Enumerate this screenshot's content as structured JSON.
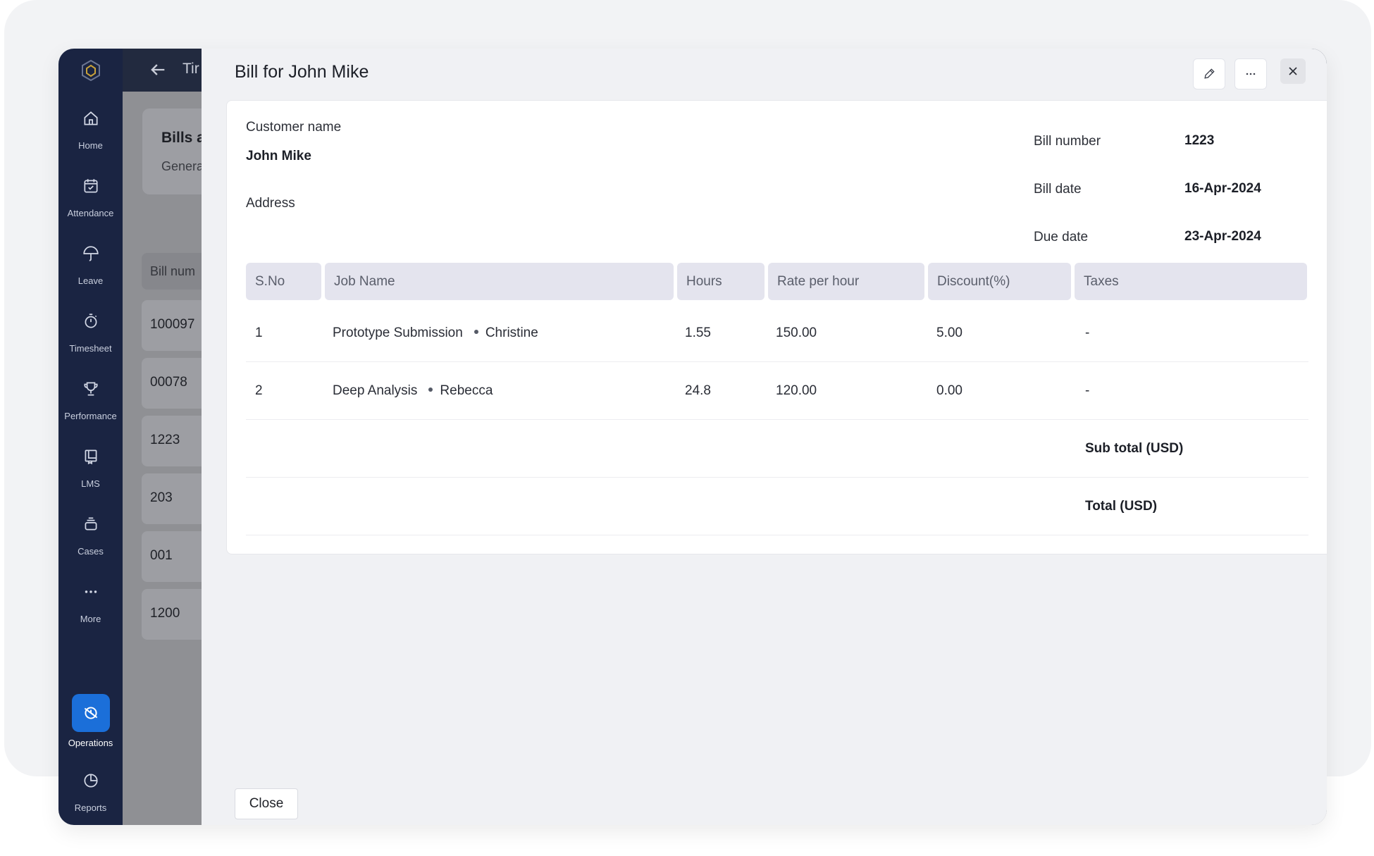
{
  "nav": {
    "items": [
      {
        "label": "Home",
        "icon": "home-icon"
      },
      {
        "label": "Attendance",
        "icon": "calendar-check-icon"
      },
      {
        "label": "Leave",
        "icon": "umbrella-icon"
      },
      {
        "label": "Timesheet",
        "icon": "timer-icon"
      },
      {
        "label": "Performance",
        "icon": "trophy-icon"
      },
      {
        "label": "LMS",
        "icon": "book-icon"
      },
      {
        "label": "Cases",
        "icon": "cases-icon"
      },
      {
        "label": "More",
        "icon": "more-icon"
      },
      {
        "label": "Operations",
        "icon": "operations-icon"
      },
      {
        "label": "Reports",
        "icon": "pie-chart-icon"
      }
    ],
    "active": "Operations",
    "accent": "#1b6fd9"
  },
  "background_page": {
    "topbar_title": "Tir",
    "card_title": "Bills a",
    "card_subtitle": "Genera",
    "column_header": "Bill num",
    "bill_numbers": [
      "100097",
      "00078",
      "1223",
      "203",
      "001",
      "1200"
    ]
  },
  "modal": {
    "title": "Bill for John Mike",
    "customer_name_label": "Customer name",
    "customer_name": "John Mike",
    "address_label": "Address",
    "bill_number_label": "Bill number",
    "bill_number": "1223",
    "bill_date_label": "Bill date",
    "bill_date": "16-Apr-2024",
    "due_date_label": "Due date",
    "due_date": "23-Apr-2024",
    "table": {
      "columns": [
        "S.No",
        "Job Name",
        "Hours",
        "Rate per hour",
        "Discount(%)",
        "Taxes"
      ],
      "rows": [
        {
          "sno": "1",
          "job": "Prototype Submission",
          "person": "Christine",
          "hours": "1.55",
          "rate": "150.00",
          "discount": "5.00",
          "taxes": "-"
        },
        {
          "sno": "2",
          "job": "Deep Analysis",
          "person": "Rebecca",
          "hours": "24.8",
          "rate": "120.00",
          "discount": "0.00",
          "taxes": "-"
        }
      ],
      "subtotal_label": "Sub total (USD)",
      "total_label": "Total (USD)"
    },
    "close_label": "Close"
  }
}
